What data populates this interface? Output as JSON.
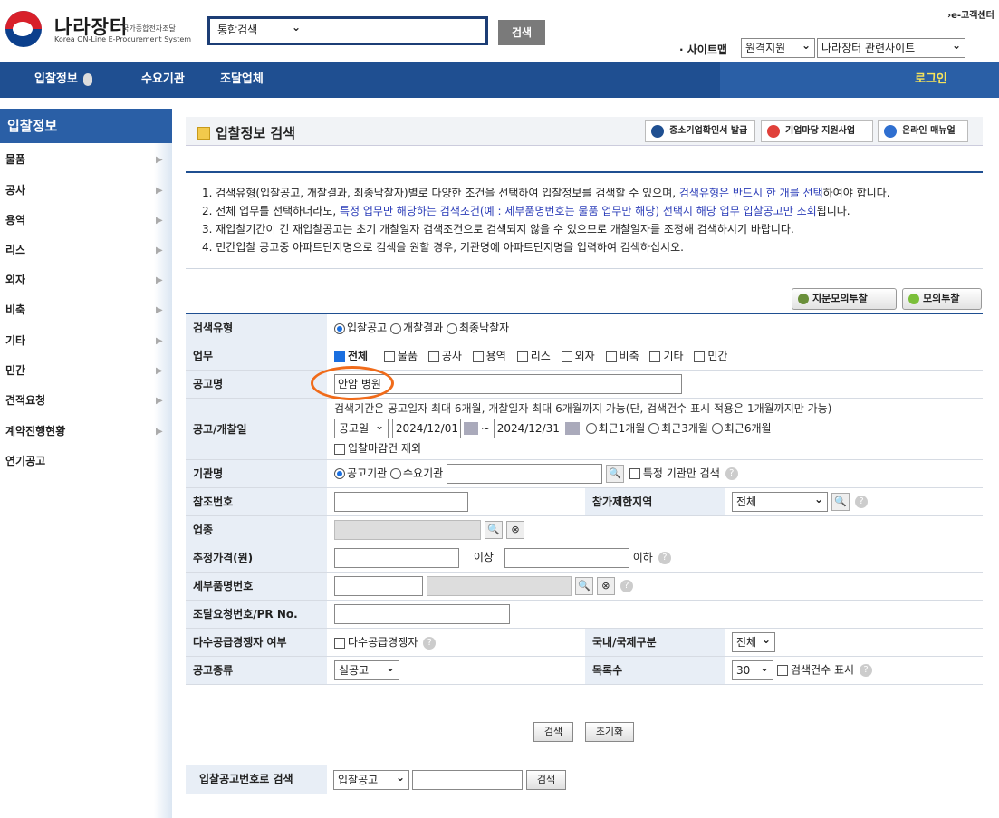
{
  "header": {
    "logo_main": "나라장터",
    "logo_sub": "국가종합전자조달",
    "logo_eng": "Korea ON-Line E-Procurement System",
    "search_type": "통합검색",
    "search_button": "검색",
    "customer_center": "›e-고객센터",
    "sitemap": "· 사이트맵",
    "region_select": "원격지원",
    "related_select": "나라장터 관련사이트"
  },
  "nav": {
    "items": [
      "입찰정보",
      "수요기관",
      "조달업체"
    ],
    "login": "로그인"
  },
  "sidebar": {
    "title": "입찰정보",
    "items": [
      "물품",
      "공사",
      "용역",
      "리스",
      "외자",
      "비축",
      "기타",
      "민간",
      "견적요청",
      "계약진행현황",
      "연기공고"
    ]
  },
  "page": {
    "title": "입찰정보 검색",
    "buttons": [
      "중소기업확인서 발급",
      "기업마당 지원사업",
      "온라인 매뉴얼"
    ]
  },
  "notice": {
    "line1_a": "1. 검색유형(입찰공고, 개찰결과, 최종낙찰자)별로 다양한 조건을 선택하여 입찰정보를 검색할 수 있으며, ",
    "line1_b": "검색유형은 반드시 한 개를 선택",
    "line1_c": "하여야 합니다.",
    "line2_a": "2. 전체 업무를 선택하더라도, ",
    "line2_b": "특정 업무만 해당하는 검색조건(예 : 세부품명번호는 물품 업무만 해당) 선택시 해당 업무 입찰공고만 조회",
    "line2_c": "됩니다.",
    "line3": "3. 재입찰기간이 긴 재입찰공고는 초기 개찰일자 검색조건으로 검색되지 않을 수 있으므로 개찰일자를 조정해 검색하시기 바랍니다.",
    "line4": "4. 민간입찰 공고중 아파트단지명으로 검색을 원할 경우, 기관명에 아파트단지명을 입력하여 검색하십시오."
  },
  "actions": {
    "mock_bid_fingerprint": "지문모의투찰",
    "mock_bid": "모의투찰"
  },
  "form": {
    "search_type_label": "검색유형",
    "search_types": [
      "입찰공고",
      "개찰결과",
      "최종낙찰자"
    ],
    "work_label": "업무",
    "works": [
      "전체",
      "물품",
      "공사",
      "용역",
      "리스",
      "외자",
      "비축",
      "기타",
      "민간"
    ],
    "notice_name_label": "공고명",
    "notice_name_value": "안암 병원",
    "date_label": "공고/개찰일",
    "date_hint": "검색기간은 공고일자 최대 6개월, 개찰일자 최대 6개월까지 가능(단, 검색건수 표시 적용은 1개월까지만 가능)",
    "date_type": "공고일",
    "date_from": "2024/12/01",
    "date_sep": "~",
    "date_to": "2024/12/31",
    "date_presets": [
      "최근1개월",
      "최근3개월",
      "최근6개월"
    ],
    "deadline_exclude": "입찰마감건 제외",
    "agency_label": "기관명",
    "agency_types": [
      "공고기관",
      "수요기관"
    ],
    "agency_only": "특정 기관만 검색",
    "ref_label": "참조번호",
    "region_label": "참가제한지역",
    "region_value": "전체",
    "industry_label": "업종",
    "price_label": "추정가격(원)",
    "price_min_suffix": "이상",
    "price_max_suffix": "이하",
    "detail_label": "세부품명번호",
    "pr_label": "조달요청번호/PR No.",
    "multi_label": "다수공급경쟁자 여부",
    "multi_check": "다수공급경쟁자",
    "intl_label": "국내/국제구분",
    "intl_value": "전체",
    "kind_label": "공고종류",
    "kind_value": "실공고",
    "rows_label": "목록수",
    "rows_value": "30",
    "show_count": "검색건수 표시"
  },
  "buttons": {
    "search": "검색",
    "reset": "초기화"
  },
  "bottom": {
    "label": "입찰공고번호로 검색",
    "type": "입찰공고",
    "search": "검색"
  }
}
